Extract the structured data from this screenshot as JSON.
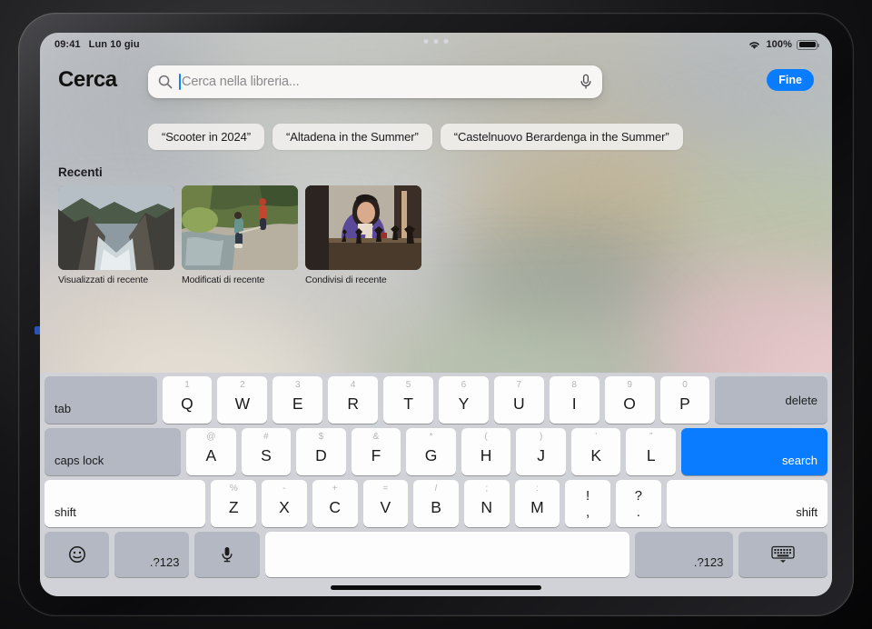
{
  "status_bar": {
    "time": "09:41",
    "date": "Lun 10 giu",
    "wifi_icon": "wifi-icon",
    "battery_percent": "100%",
    "battery_icon": "battery-icon",
    "multitask_icon": "multitasking-dots-icon"
  },
  "header": {
    "title": "Cerca",
    "done_label": "Fine",
    "search_icon": "search-icon",
    "mic_icon": "microphone-icon"
  },
  "search": {
    "value": "",
    "placeholder": "Cerca nella libreria..."
  },
  "suggestions": [
    {
      "label": "“Scooter in 2024”"
    },
    {
      "label": "“Altadena in the Summer”"
    },
    {
      "label": "“Castelnuovo Berardenga in the Summer”"
    }
  ],
  "recents": {
    "title": "Recenti",
    "items": [
      {
        "label": "Visualizzati di recente",
        "thumb": "coastal-cliffs-photo"
      },
      {
        "label": "Modificati di recente",
        "thumb": "people-in-stream-photo"
      },
      {
        "label": "Condivisi di recente",
        "thumb": "girl-playing-chess-photo"
      }
    ]
  },
  "keyboard": {
    "row1": [
      {
        "name": "tab",
        "main": "tab",
        "type": "mod",
        "align": "bottom-left",
        "flex": 2.05
      },
      {
        "name": "q",
        "main": "Q",
        "alt": "1"
      },
      {
        "name": "w",
        "main": "W",
        "alt": "2"
      },
      {
        "name": "e",
        "main": "E",
        "alt": "3"
      },
      {
        "name": "r",
        "main": "R",
        "alt": "4"
      },
      {
        "name": "t",
        "main": "T",
        "alt": "5"
      },
      {
        "name": "y",
        "main": "Y",
        "alt": "6"
      },
      {
        "name": "u",
        "main": "U",
        "alt": "7"
      },
      {
        "name": "i",
        "main": "I",
        "alt": "8"
      },
      {
        "name": "o",
        "main": "O",
        "alt": "9"
      },
      {
        "name": "p",
        "main": "P",
        "alt": "0"
      },
      {
        "name": "delete",
        "main": "delete",
        "type": "mod",
        "align": "right",
        "flex": 2.05
      }
    ],
    "row2": [
      {
        "name": "caps-lock",
        "main": "caps lock",
        "type": "mod",
        "align": "bottom-left",
        "flex": 2.55
      },
      {
        "name": "a",
        "main": "A",
        "alt": "@"
      },
      {
        "name": "s",
        "main": "S",
        "alt": "#"
      },
      {
        "name": "d",
        "main": "D",
        "alt": "$"
      },
      {
        "name": "f",
        "main": "F",
        "alt": "&"
      },
      {
        "name": "g",
        "main": "G",
        "alt": "*"
      },
      {
        "name": "h",
        "main": "H",
        "alt": "("
      },
      {
        "name": "j",
        "main": "J",
        "alt": ")"
      },
      {
        "name": "k",
        "main": "K",
        "alt": "’"
      },
      {
        "name": "l",
        "main": "L",
        "alt": "”"
      },
      {
        "name": "search-return",
        "main": "search",
        "type": "blue",
        "align": "bottom-right",
        "flex": 2.75
      }
    ],
    "row3": [
      {
        "name": "shift-left",
        "main": "shift",
        "type": "white-mod",
        "align": "bottom-left",
        "flex": 3.35
      },
      {
        "name": "z",
        "main": "Z",
        "alt": "%"
      },
      {
        "name": "x",
        "main": "X",
        "alt": "-"
      },
      {
        "name": "c",
        "main": "C",
        "alt": "+"
      },
      {
        "name": "v",
        "main": "V",
        "alt": "="
      },
      {
        "name": "b",
        "main": "B",
        "alt": "/"
      },
      {
        "name": "n",
        "main": "N",
        "alt": ";"
      },
      {
        "name": "m",
        "main": "M",
        "alt": ":"
      },
      {
        "name": "exclam-comma",
        "top": "!",
        "bot": ",",
        "type": "stack"
      },
      {
        "name": "question-period",
        "top": "?",
        "bot": ".",
        "type": "stack"
      },
      {
        "name": "shift-right",
        "main": "shift",
        "type": "white-mod",
        "align": "bottom-right",
        "flex": 3.35
      }
    ],
    "row4": [
      {
        "name": "emoji",
        "icon": "emoji-icon",
        "type": "mod",
        "flex": 1.35
      },
      {
        "name": "numbers-left",
        "main": ".?123",
        "type": "mod",
        "align": "bottom-right",
        "flex": 1.35
      },
      {
        "name": "dictation",
        "icon": "microphone-icon",
        "type": "mod",
        "flex": 1.35
      },
      {
        "name": "space",
        "main": "",
        "type": "space",
        "flex": 7.6
      },
      {
        "name": "numbers-right",
        "main": ".?123",
        "type": "mod",
        "align": "bottom-right",
        "flex": 1.85
      },
      {
        "name": "dismiss-keyboard",
        "icon": "hide-keyboard-icon",
        "type": "mod",
        "flex": 1.85
      }
    ]
  }
}
